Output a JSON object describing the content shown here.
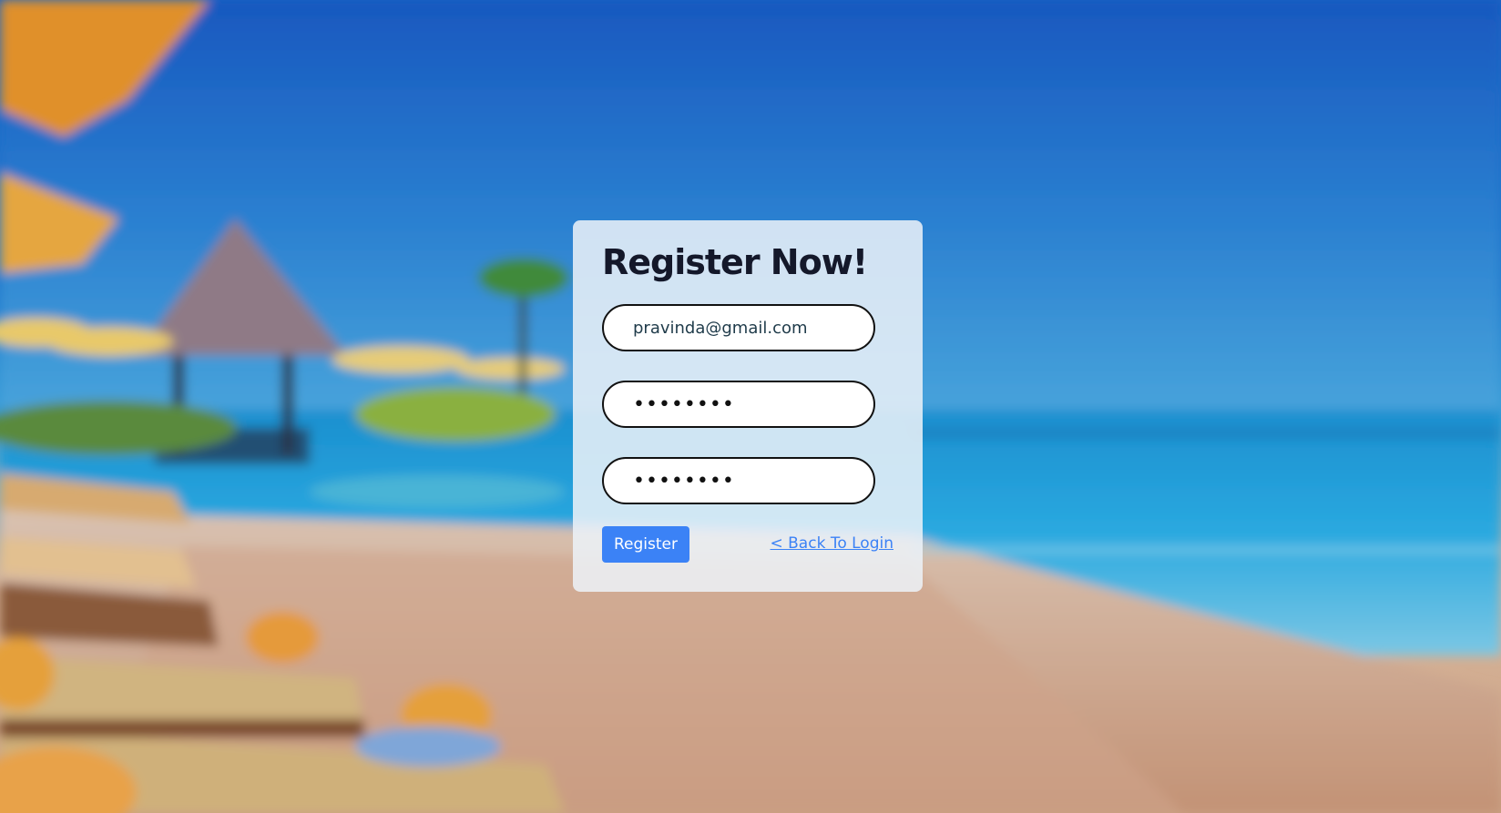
{
  "page": {
    "title": "Register Now!"
  },
  "form": {
    "email_value": "pravinda@gmail.com",
    "password_value": "password",
    "confirm_password_value": "password",
    "register_label": "Register",
    "back_link_label": "< Back To Login"
  },
  "colors": {
    "accent": "#3b82f6",
    "card_background": "#ecf2f8",
    "heading": "#14182a"
  },
  "background": {
    "icon": "beach-resort-image"
  }
}
